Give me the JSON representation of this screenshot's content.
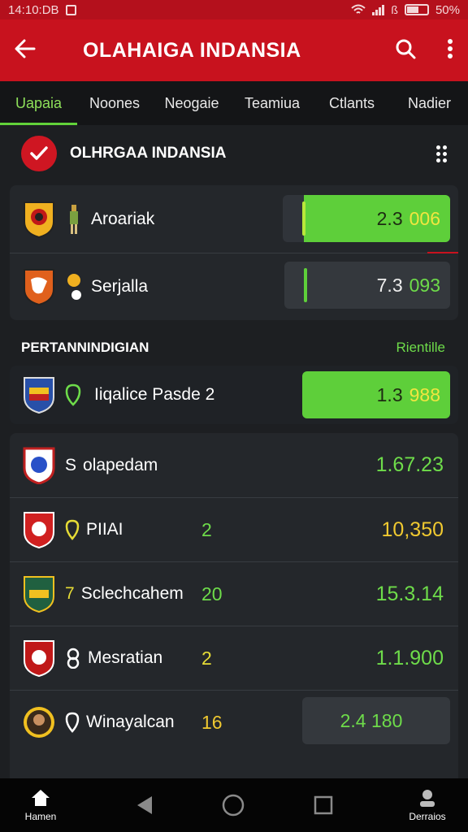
{
  "status_bar": {
    "time": "14:10:DB",
    "battery": "50%"
  },
  "app_bar": {
    "title": "OLAHAIGA INDANSIA"
  },
  "tabs": [
    {
      "label": "Uapaia",
      "active": true
    },
    {
      "label": "Noones",
      "active": false
    },
    {
      "label": "Neogaie",
      "active": false
    },
    {
      "label": "Teamiua",
      "active": false
    },
    {
      "label": "Ctlants",
      "active": false
    },
    {
      "label": "Nadier",
      "active": false
    }
  ],
  "league_header": {
    "name": "OLHRGAA INDANSIA"
  },
  "featured": [
    {
      "name": "Aroariak",
      "odd_main": "2.3",
      "odd_alt": "006",
      "style": "green"
    },
    {
      "name": "Serjalla",
      "odd_main": "7.3",
      "odd_alt": "093",
      "style": "dark"
    }
  ],
  "section": {
    "title": "PERTANNINDIGIAN",
    "link": "Rientille"
  },
  "highlight": {
    "name": "Iiqalice Pasde 2",
    "odd_main": "1.3",
    "odd_alt": "988"
  },
  "matches": [
    {
      "lead": "S",
      "name": "olapedam",
      "num": "",
      "value": "1.67.23",
      "value_color": "green"
    },
    {
      "lead": "",
      "name": "PIIAI",
      "num": "2",
      "value": "10,350",
      "value_color": "yellow"
    },
    {
      "lead": "7",
      "name": "Sclechcahem",
      "num": "20",
      "value": "15.3.14",
      "value_color": "green"
    },
    {
      "lead": "",
      "name": "Mesratian",
      "num": "2",
      "value": "1.1.900",
      "value_color": "green"
    },
    {
      "lead": "",
      "name": "Winayalcan",
      "num": "16",
      "value": "2.4 180",
      "value_color": "green"
    }
  ],
  "bottom_nav": {
    "home_label": "Hamen",
    "profile_label": "Derraios"
  },
  "colors": {
    "brand_red": "#c8121e",
    "accent_green": "#5ecf3a",
    "odds_yellow": "#f0c930"
  }
}
